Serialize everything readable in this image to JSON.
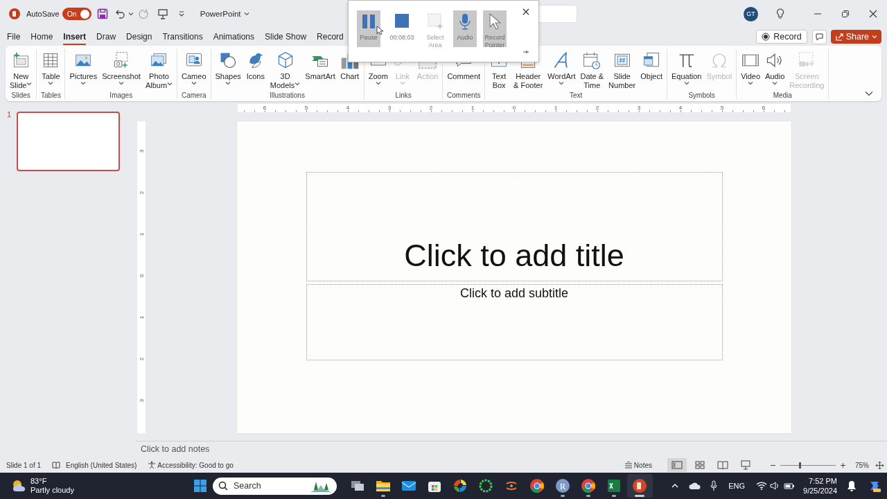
{
  "title_bar": {
    "autosave_label": "AutoSave",
    "autosave": {
      "label": "On",
      "on": true
    },
    "app_name": "PowerPoint",
    "account_initials": "GT"
  },
  "tabs": [
    {
      "label": "File",
      "selected": false
    },
    {
      "label": "Home",
      "selected": false
    },
    {
      "label": "Insert",
      "selected": true
    },
    {
      "label": "Draw",
      "selected": false
    },
    {
      "label": "Design",
      "selected": false
    },
    {
      "label": "Transitions",
      "selected": false
    },
    {
      "label": "Animations",
      "selected": false
    },
    {
      "label": "Slide Show",
      "selected": false
    },
    {
      "label": "Record",
      "selected": false
    }
  ],
  "header_buttons": {
    "record": "Record",
    "share": "Share"
  },
  "ribbon": {
    "groups": [
      {
        "label": "Slides",
        "items": [
          {
            "label": "New\nSlide",
            "dropdown": true,
            "disabled": false
          }
        ]
      },
      {
        "label": "Tables",
        "items": [
          {
            "label": "Table",
            "dropdown": true,
            "disabled": false
          }
        ]
      },
      {
        "label": "Images",
        "items": [
          {
            "label": "Pictures",
            "dropdown": true,
            "disabled": false
          },
          {
            "label": "Screenshot",
            "dropdown": true,
            "disabled": false
          },
          {
            "label": "Photo\nAlbum",
            "dropdown": true,
            "disabled": false
          }
        ]
      },
      {
        "label": "Camera",
        "items": [
          {
            "label": "Cameo",
            "dropdown": true,
            "disabled": false
          }
        ]
      },
      {
        "label": "Illustrations",
        "items": [
          {
            "label": "Shapes",
            "dropdown": true,
            "disabled": false
          },
          {
            "label": "Icons",
            "dropdown": false,
            "disabled": false
          },
          {
            "label": "3D\nModels",
            "dropdown": true,
            "disabled": false
          },
          {
            "label": "SmartArt",
            "dropdown": false,
            "disabled": false
          },
          {
            "label": "Chart",
            "dropdown": false,
            "disabled": false
          }
        ]
      },
      {
        "label": "Links",
        "items": [
          {
            "label": "Zoom",
            "dropdown": true,
            "disabled": false
          },
          {
            "label": "Link",
            "dropdown": true,
            "disabled": true
          },
          {
            "label": "Action",
            "dropdown": false,
            "disabled": true
          }
        ]
      },
      {
        "label": "Comments",
        "items": [
          {
            "label": "Comment",
            "dropdown": false,
            "disabled": false
          }
        ]
      },
      {
        "label": "Text",
        "items": [
          {
            "label": "Text\nBox",
            "dropdown": false,
            "disabled": false
          },
          {
            "label": "Header\n& Footer",
            "dropdown": false,
            "disabled": false
          },
          {
            "label": "WordArt",
            "dropdown": true,
            "disabled": false
          },
          {
            "label": "Date &\nTime",
            "dropdown": false,
            "disabled": false
          },
          {
            "label": "Slide\nNumber",
            "dropdown": false,
            "disabled": false
          },
          {
            "label": "Object",
            "dropdown": false,
            "disabled": false
          }
        ]
      },
      {
        "label": "Symbols",
        "items": [
          {
            "label": "Equation",
            "dropdown": true,
            "disabled": false
          },
          {
            "label": "Symbol",
            "dropdown": false,
            "disabled": true
          }
        ]
      },
      {
        "label": "Media",
        "items": [
          {
            "label": "Video",
            "dropdown": true,
            "disabled": false
          },
          {
            "label": "Audio",
            "dropdown": true,
            "disabled": false
          },
          {
            "label": "Screen\nRecording",
            "dropdown": false,
            "disabled": true
          }
        ]
      }
    ]
  },
  "recorder": {
    "buttons": [
      {
        "kind": "pause",
        "label": "Pause",
        "on": true,
        "disabled": false
      },
      {
        "kind": "timer",
        "label": "00:08:03"
      },
      {
        "kind": "area",
        "label": "Select\nArea",
        "on": false,
        "disabled": true
      },
      {
        "kind": "audio",
        "label": "Audio",
        "on": true,
        "disabled": false
      },
      {
        "kind": "pointer",
        "label": "Record\nPointer",
        "on": true,
        "disabled": false
      }
    ]
  },
  "slides_panel": {
    "thumbnails": [
      {
        "number": "1",
        "selected": true
      }
    ]
  },
  "rulers": {
    "horizontal": [
      "6",
      "5",
      "4",
      "3",
      "2",
      "1",
      "0",
      "1",
      "2",
      "3",
      "4",
      "5",
      "6"
    ],
    "vertical": [
      "3",
      "2",
      "1",
      "0",
      "1",
      "2",
      "3"
    ]
  },
  "slide": {
    "title_placeholder": "Click to add title",
    "subtitle_placeholder": "Click to add subtitle"
  },
  "notes": {
    "placeholder": "Click to add notes"
  },
  "status_bar": {
    "slide_position": "Slide 1 of 1",
    "language": "English (United States)",
    "accessibility": "Accessibility: Good to go",
    "notes_button": "Notes",
    "views": [
      {
        "kind": "normal",
        "selected": true
      },
      {
        "kind": "sorter",
        "selected": false
      },
      {
        "kind": "reading",
        "selected": false
      },
      {
        "kind": "slideshow",
        "selected": false
      }
    ],
    "zoom": {
      "level": 0.35,
      "reading": "75%"
    }
  },
  "taskbar": {
    "weather": {
      "temperature": "83°F",
      "condition": "Partly cloudy"
    },
    "search": {
      "placeholder": "Search"
    },
    "apps": [
      {
        "kind": "taskview",
        "running": false,
        "selected": false
      },
      {
        "kind": "folder",
        "running": true,
        "selected": false
      },
      {
        "kind": "mail",
        "running": false,
        "selected": false
      },
      {
        "kind": "store",
        "running": false,
        "selected": false
      },
      {
        "kind": "swirl",
        "running": false,
        "selected": false
      },
      {
        "kind": "ring",
        "running": false,
        "selected": false
      },
      {
        "kind": "orbit",
        "running": false,
        "selected": false
      },
      {
        "kind": "browser",
        "running": false,
        "selected": false
      },
      {
        "kind": "letter",
        "label": "R",
        "running": true,
        "selected": false
      },
      {
        "kind": "browser",
        "running": true,
        "selected": false
      },
      {
        "kind": "sheet",
        "running": true,
        "selected": false
      },
      {
        "kind": "slides",
        "running": true,
        "selected": true
      }
    ],
    "tray": {
      "language": "ENG",
      "time": "7:52 PM",
      "date": "9/25/2024"
    }
  }
}
